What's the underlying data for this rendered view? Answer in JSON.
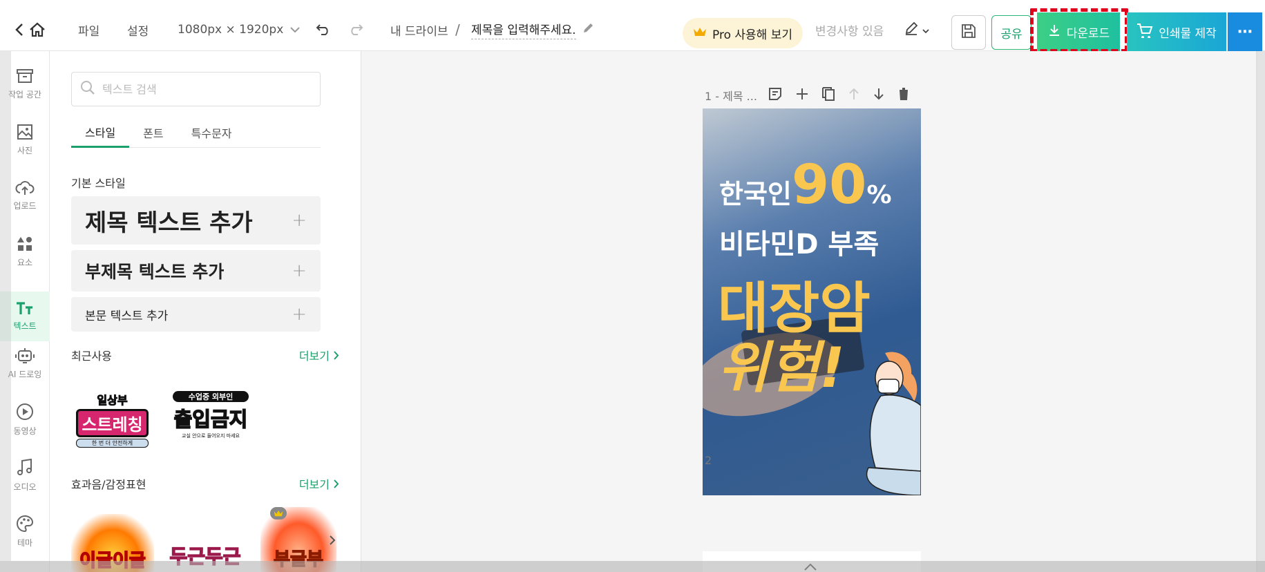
{
  "topbar": {
    "file_label": "파일",
    "settings_label": "설정",
    "size_label": "1080px × 1920px",
    "drive_label": "내 드라이브",
    "breadcrumb_sep": "/",
    "doc_title": "제목을 입력해주세요.",
    "pro_label": "Pro 사용해 보기",
    "changes_label": "변경사항 있음",
    "share_label": "공유",
    "download_label": "다운로드",
    "print_label": "인쇄물 제작",
    "more_label": "⋯"
  },
  "rail": {
    "items": [
      {
        "label": "작업 공간",
        "icon": "archive-icon"
      },
      {
        "label": "사진",
        "icon": "image-icon"
      },
      {
        "label": "업로드",
        "icon": "cloud-upload-icon"
      },
      {
        "label": "요소",
        "icon": "shapes-icon"
      },
      {
        "label": "텍스트",
        "icon": "text-icon"
      },
      {
        "label": "AI 드로잉",
        "icon": "robot-icon"
      },
      {
        "label": "동영상",
        "icon": "play-icon"
      },
      {
        "label": "오디오",
        "icon": "music-icon"
      },
      {
        "label": "테마",
        "icon": "palette-icon"
      }
    ],
    "active": "텍스트"
  },
  "panel": {
    "search_placeholder": "텍스트 검색",
    "tabs": [
      "스타일",
      "폰트",
      "특수문자"
    ],
    "basic_style_title": "기본 스타일",
    "add_title": "제목 텍스트 추가",
    "add_subtitle": "부제목 텍스트 추가",
    "add_body": "본문 텍스트 추가",
    "recent_title": "최근사용",
    "effects_title": "효과음/감정표현",
    "more_label": "더보기",
    "recent_stickers": [
      {
        "line1": "일상부",
        "line2": "스트레칭",
        "line3": "한 번 더 안전하게"
      },
      {
        "line1": "수업중 외부인",
        "line2": "출입금지",
        "line3": "교실 안으로 들어오지 마세요"
      }
    ],
    "effect_stickers": [
      "이글이글",
      "두근두근",
      "부글부"
    ]
  },
  "canvas": {
    "page1_label": "1 - 제목 ...",
    "page2_label": "2",
    "poster": {
      "line1_prefix": "한국인",
      "line1_number": "90",
      "line1_suffix": "%",
      "line2": "비타민D 부족",
      "line3": "대장암",
      "line4": "위험!"
    }
  },
  "colors": {
    "accent": "#1aa06a",
    "download": "#3ccf85",
    "print": "#1aa6d6",
    "highlight": "#e0001b",
    "poster_yellow": "#f9c74f"
  }
}
